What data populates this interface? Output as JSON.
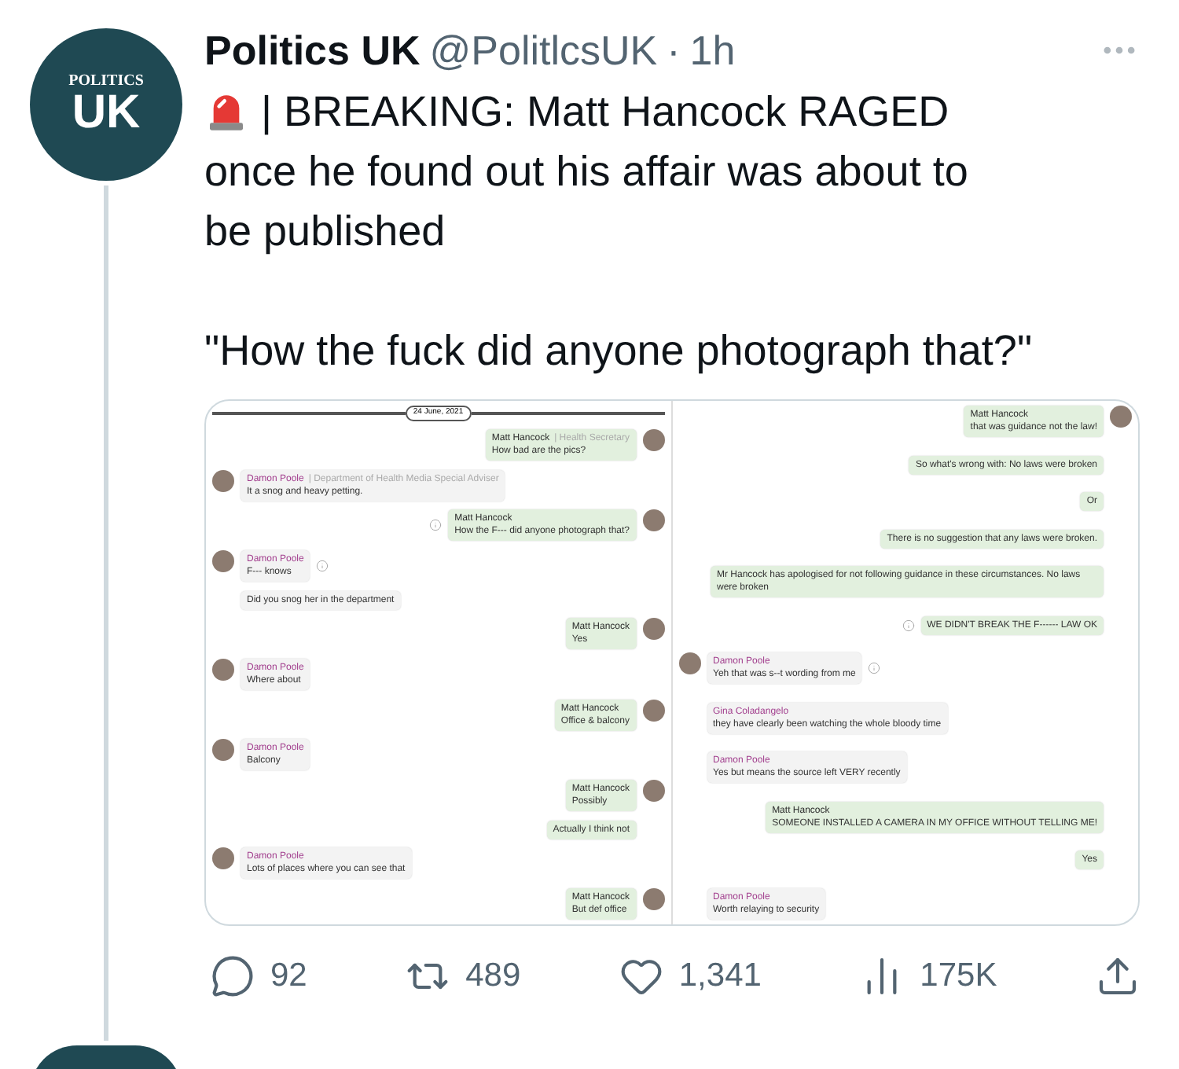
{
  "tweet": {
    "logo": {
      "top": "POLITICS",
      "main": "UK"
    },
    "name": "Politics UK",
    "handle": "@PolitlcsUK",
    "separator": "·",
    "time": "1h",
    "text_lines": [
      "| BREAKING: Matt Hancock RAGED once he found out his affair was about to be published",
      "\"How the fuck did anyone photograph that?\""
    ]
  },
  "image": {
    "panels": [
      {
        "date": "24 June, 2021",
        "messages": [
          {
            "kind": "out",
            "sender": "Matt Hancock",
            "role": "| Health Secretary",
            "text": "How bad are the pics?",
            "avatar": true,
            "info": false
          },
          {
            "kind": "in",
            "sender": "Damon Poole",
            "role": "| Department of Health Media Special Adviser",
            "text": "It a snog and heavy petting.",
            "avatar": true,
            "info": false
          },
          {
            "kind": "out",
            "sender": "Matt Hancock",
            "text": "How the F--- did anyone photograph that?",
            "avatar": true,
            "info": true
          },
          {
            "kind": "in",
            "sender": "Damon Poole",
            "text": "F--- knows",
            "avatar": true,
            "info": true
          },
          {
            "kind": "in",
            "text": "Did you snog her in the department",
            "avatar": false,
            "info": false
          },
          {
            "kind": "out",
            "sender": "Matt Hancock",
            "text": "Yes",
            "avatar": true,
            "info": false
          },
          {
            "kind": "in",
            "sender": "Damon Poole",
            "text": "Where about",
            "avatar": true,
            "info": false
          },
          {
            "kind": "out",
            "sender": "Matt Hancock",
            "text": "Office & balcony",
            "avatar": true,
            "info": false
          },
          {
            "kind": "in",
            "sender": "Damon Poole",
            "text": "Balcony",
            "avatar": true,
            "info": false
          },
          {
            "kind": "out",
            "sender": "Matt Hancock",
            "text": "Possibly",
            "avatar": true,
            "info": false
          },
          {
            "kind": "out",
            "text": "Actually I think not",
            "avatar": false,
            "info": false
          },
          {
            "kind": "in",
            "sender": "Damon Poole",
            "text": "Lots of places where you can see that",
            "avatar": true,
            "info": false
          },
          {
            "kind": "out",
            "sender": "Matt Hancock",
            "text": "But def office",
            "avatar": true,
            "info": false
          }
        ]
      },
      {
        "messages": [
          {
            "kind": "out",
            "sender": "Matt Hancock",
            "text": "that was guidance not the law!",
            "avatar": true,
            "info": false
          },
          {
            "kind": "out",
            "text": "So what's wrong with: No laws were broken",
            "avatar": false,
            "info": false
          },
          {
            "kind": "out",
            "text": "Or",
            "avatar": false,
            "info": false
          },
          {
            "kind": "out",
            "text": "There is no suggestion that any laws were broken.",
            "avatar": false,
            "info": false
          },
          {
            "kind": "out",
            "text": "Mr Hancock has apologised for not following guidance in these circumstances. No laws were broken",
            "avatar": false,
            "info": false
          },
          {
            "kind": "out",
            "text": "WE DIDN'T BREAK THE F------ LAW OK",
            "avatar": false,
            "info": true
          },
          {
            "kind": "in",
            "sender": "Damon Poole",
            "text": "Yeh that was s--t wording from me",
            "avatar": true,
            "info": true
          },
          {
            "kind": "in",
            "sender": "Gina Coladangelo",
            "text": "they have clearly been watching the whole bloody time",
            "avatar": false,
            "info": false
          },
          {
            "kind": "in",
            "sender": "Damon Poole",
            "text": "Yes but means the source left VERY recently",
            "avatar": false,
            "info": false
          },
          {
            "kind": "out",
            "sender": "Matt Hancock",
            "text": "SOMEONE INSTALLED A CAMERA IN MY OFFICE WITHOUT TELLING ME!",
            "avatar": false,
            "info": false
          },
          {
            "kind": "out",
            "text": "Yes",
            "avatar": false,
            "info": false
          },
          {
            "kind": "in",
            "sender": "Damon Poole",
            "text": "Worth relaying to security",
            "avatar": false,
            "info": false
          }
        ]
      }
    ]
  },
  "actions": [
    {
      "kind": "reply",
      "count": "92"
    },
    {
      "kind": "repost",
      "count": "489"
    },
    {
      "kind": "like",
      "count": "1,341"
    },
    {
      "kind": "views",
      "count": "175K"
    },
    {
      "kind": "share"
    }
  ]
}
